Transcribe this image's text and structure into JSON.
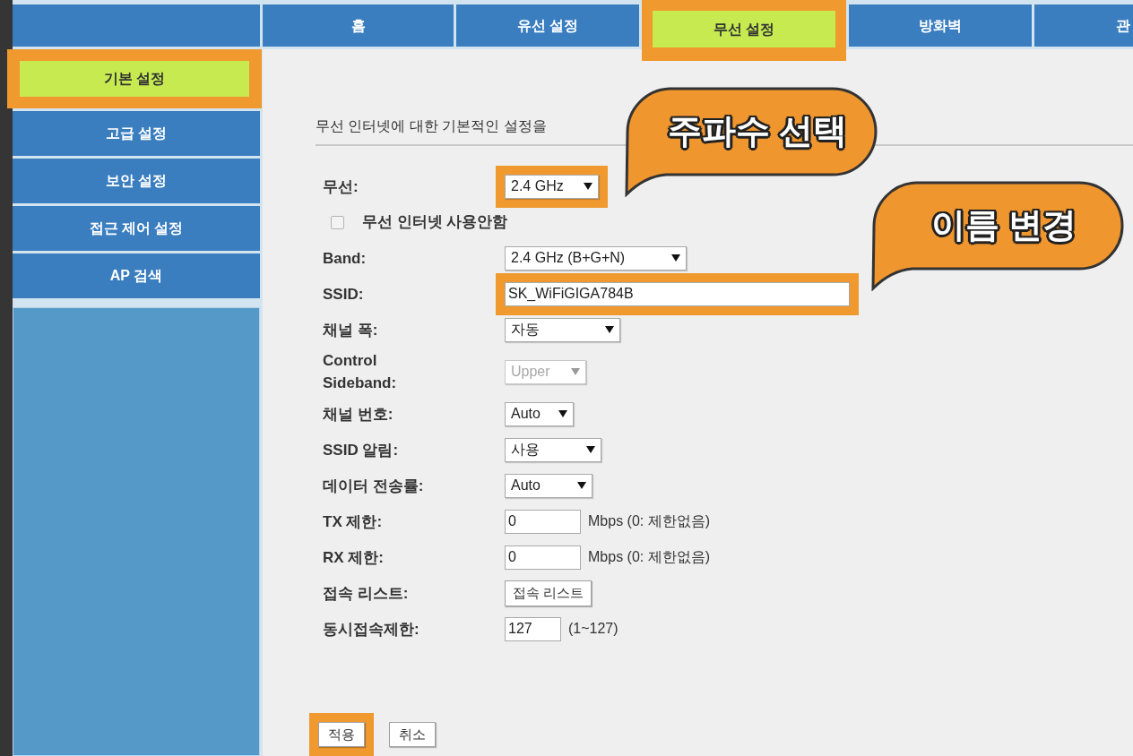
{
  "top_tabs": [
    {
      "label": "홈",
      "selected": false,
      "highlighted": false
    },
    {
      "label": "유선 설정",
      "selected": false,
      "highlighted": false
    },
    {
      "label": "무선 설정",
      "selected": true,
      "highlighted": true
    },
    {
      "label": "방화벽",
      "selected": false,
      "highlighted": false
    },
    {
      "label": "관",
      "selected": false,
      "highlighted": false
    }
  ],
  "sidebar": {
    "items": [
      {
        "label": "기본 설정",
        "selected": true,
        "highlighted": true
      },
      {
        "label": "고급 설정",
        "selected": false,
        "highlighted": false
      },
      {
        "label": "보안 설정",
        "selected": false,
        "highlighted": false
      },
      {
        "label": "접근 제어 설정",
        "selected": false,
        "highlighted": false
      },
      {
        "label": "AP 검색",
        "selected": false,
        "highlighted": false
      }
    ]
  },
  "description": "무선 인터넷에 대한 기본적인 설정을",
  "form_rows": [
    {
      "kind": "select",
      "label": "무선:",
      "value": "2.4 GHz",
      "disabled": false,
      "highlighted": true
    },
    {
      "kind": "checkbox",
      "label": "무선 인터넷 사용안함",
      "checked": false,
      "highlighted": false
    },
    {
      "kind": "select",
      "label": "Band:",
      "value": "2.4 GHz (B+G+N)",
      "disabled": false,
      "highlighted": false
    },
    {
      "kind": "text",
      "label": "SSID:",
      "value": "SK_WiFiGIGA784B",
      "highlighted": true
    },
    {
      "kind": "select",
      "label": "채널 폭:",
      "value": "자동",
      "disabled": false,
      "highlighted": false
    },
    {
      "kind": "select",
      "label": "Control Sideband:",
      "value": "Upper",
      "disabled": true,
      "highlighted": false
    },
    {
      "kind": "select",
      "label": "채널 번호:",
      "value": "Auto",
      "disabled": false,
      "highlighted": false
    },
    {
      "kind": "select",
      "label": "SSID 알림:",
      "value": "사용",
      "disabled": false,
      "highlighted": false
    },
    {
      "kind": "select",
      "label": "데이터 전송률:",
      "value": "Auto",
      "disabled": false,
      "highlighted": false
    },
    {
      "kind": "text",
      "label": "TX 제한:",
      "value": "0",
      "suffix": "Mbps (0: 제한없음)",
      "highlighted": false
    },
    {
      "kind": "text",
      "label": "RX 제한:",
      "value": "0",
      "suffix": "Mbps (0: 제한없음)",
      "highlighted": false
    },
    {
      "kind": "button",
      "label": "접속 리스트:",
      "button": "접속 리스트",
      "highlighted": false
    },
    {
      "kind": "text",
      "label": "동시접속제한:",
      "value": "127",
      "suffix": "(1~127)",
      "highlighted": false
    }
  ],
  "buttons": [
    {
      "label": "적용",
      "highlighted": true
    },
    {
      "label": "취소",
      "highlighted": false
    }
  ],
  "callouts": [
    {
      "text": "주파수 선택"
    },
    {
      "text": "이름 변경"
    }
  ]
}
